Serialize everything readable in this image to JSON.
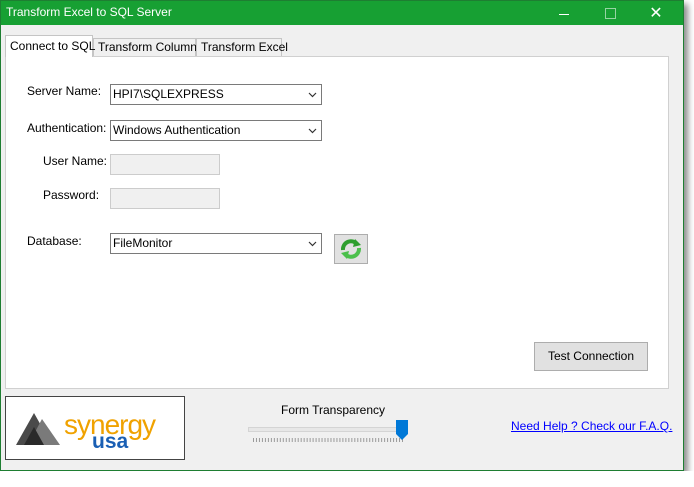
{
  "window": {
    "title": "Transform Excel to SQL Server",
    "controls": {
      "minimize": "minimize-icon",
      "maximize": "maximize-icon",
      "close": "✕"
    }
  },
  "tabs": [
    {
      "label": "Connect to SQL",
      "active": true
    },
    {
      "label": "Transform Columns",
      "active": false
    },
    {
      "label": "Transform Excel",
      "active": false
    }
  ],
  "connection": {
    "server_label": "Server Name:",
    "server_value": "HPI7\\SQLEXPRESS",
    "auth_label": "Authentication:",
    "auth_value": "Windows Authentication",
    "user_label": "User Name:",
    "user_value": "",
    "password_label": "Password:",
    "password_value": "",
    "database_label": "Database:",
    "database_value": "FileMonitor",
    "refresh_icon": "refresh-icon",
    "test_button": "Test Connection"
  },
  "footer": {
    "logo_text_1": "synergy",
    "logo_text_2": "usa",
    "transparency_label": "Form Transparency",
    "transparency_value": 1.0,
    "help_link": "Need Help ? Check our F.A.Q."
  },
  "colors": {
    "titlebar": "#17a033",
    "logo_orange": "#f0a200",
    "logo_blue": "#1a5fb4",
    "link": "#0000ff",
    "slider_thumb": "#0078d7"
  }
}
